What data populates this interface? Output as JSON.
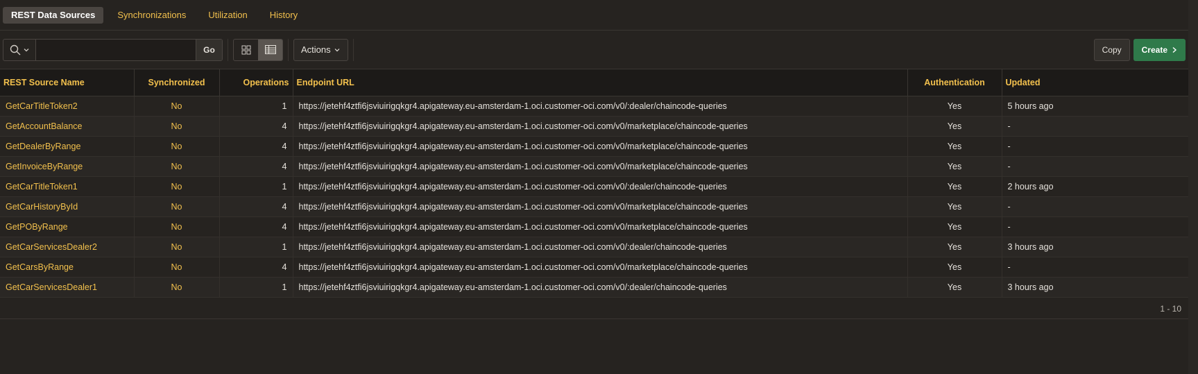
{
  "tabs": [
    {
      "label": "REST Data Sources",
      "active": true
    },
    {
      "label": "Synchronizations",
      "active": false
    },
    {
      "label": "Utilization",
      "active": false
    },
    {
      "label": "History",
      "active": false
    }
  ],
  "toolbar": {
    "search_icon": "search-icon",
    "search_value": "",
    "go_label": "Go",
    "actions_label": "Actions",
    "copy_label": "Copy",
    "create_label": "Create"
  },
  "table": {
    "columns": [
      "REST Source Name",
      "Synchronized",
      "Operations",
      "Endpoint URL",
      "Authentication",
      "Updated"
    ],
    "rows": [
      [
        "GetCarTitleToken2",
        "No",
        "1",
        "https://jetehf4ztfi6jsviuirigqkgr4.apigateway.eu-amsterdam-1.oci.customer-oci.com/v0/:dealer/chaincode-queries",
        "Yes",
        "5 hours ago"
      ],
      [
        "GetAccountBalance",
        "No",
        "4",
        "https://jetehf4ztfi6jsviuirigqkgr4.apigateway.eu-amsterdam-1.oci.customer-oci.com/v0/marketplace/chaincode-queries",
        "Yes",
        "-"
      ],
      [
        "GetDealerByRange",
        "No",
        "4",
        "https://jetehf4ztfi6jsviuirigqkgr4.apigateway.eu-amsterdam-1.oci.customer-oci.com/v0/marketplace/chaincode-queries",
        "Yes",
        "-"
      ],
      [
        "GetInvoiceByRange",
        "No",
        "4",
        "https://jetehf4ztfi6jsviuirigqkgr4.apigateway.eu-amsterdam-1.oci.customer-oci.com/v0/marketplace/chaincode-queries",
        "Yes",
        "-"
      ],
      [
        "GetCarTitleToken1",
        "No",
        "1",
        "https://jetehf4ztfi6jsviuirigqkgr4.apigateway.eu-amsterdam-1.oci.customer-oci.com/v0/:dealer/chaincode-queries",
        "Yes",
        "2 hours ago"
      ],
      [
        "GetCarHistoryById",
        "No",
        "4",
        "https://jetehf4ztfi6jsviuirigqkgr4.apigateway.eu-amsterdam-1.oci.customer-oci.com/v0/marketplace/chaincode-queries",
        "Yes",
        "-"
      ],
      [
        "GetPOByRange",
        "No",
        "4",
        "https://jetehf4ztfi6jsviuirigqkgr4.apigateway.eu-amsterdam-1.oci.customer-oci.com/v0/marketplace/chaincode-queries",
        "Yes",
        "-"
      ],
      [
        "GetCarServicesDealer2",
        "No",
        "1",
        "https://jetehf4ztfi6jsviuirigqkgr4.apigateway.eu-amsterdam-1.oci.customer-oci.com/v0/:dealer/chaincode-queries",
        "Yes",
        "3 hours ago"
      ],
      [
        "GetCarsByRange",
        "No",
        "4",
        "https://jetehf4ztfi6jsviuirigqkgr4.apigateway.eu-amsterdam-1.oci.customer-oci.com/v0/marketplace/chaincode-queries",
        "Yes",
        "-"
      ],
      [
        "GetCarServicesDealer1",
        "No",
        "1",
        "https://jetehf4ztfi6jsviuirigqkgr4.apigateway.eu-amsterdam-1.oci.customer-oci.com/v0/:dealer/chaincode-queries",
        "Yes",
        "3 hours ago"
      ]
    ]
  },
  "pagination": {
    "range": "1 - 10"
  },
  "colors": {
    "accent": "#f2c04d",
    "create": "#2f7a4a",
    "background": "#262320"
  }
}
